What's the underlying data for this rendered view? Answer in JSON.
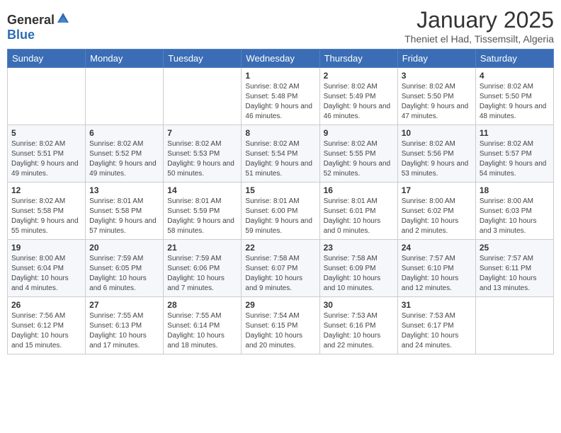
{
  "header": {
    "logo_general": "General",
    "logo_blue": "Blue",
    "month_title": "January 2025",
    "subtitle": "Theniet el Had, Tissemsilt, Algeria"
  },
  "days_of_week": [
    "Sunday",
    "Monday",
    "Tuesday",
    "Wednesday",
    "Thursday",
    "Friday",
    "Saturday"
  ],
  "weeks": [
    [
      {
        "day": "",
        "sunrise": "",
        "sunset": "",
        "daylight": ""
      },
      {
        "day": "",
        "sunrise": "",
        "sunset": "",
        "daylight": ""
      },
      {
        "day": "",
        "sunrise": "",
        "sunset": "",
        "daylight": ""
      },
      {
        "day": "1",
        "sunrise": "Sunrise: 8:02 AM",
        "sunset": "Sunset: 5:48 PM",
        "daylight": "Daylight: 9 hours and 46 minutes."
      },
      {
        "day": "2",
        "sunrise": "Sunrise: 8:02 AM",
        "sunset": "Sunset: 5:49 PM",
        "daylight": "Daylight: 9 hours and 46 minutes."
      },
      {
        "day": "3",
        "sunrise": "Sunrise: 8:02 AM",
        "sunset": "Sunset: 5:50 PM",
        "daylight": "Daylight: 9 hours and 47 minutes."
      },
      {
        "day": "4",
        "sunrise": "Sunrise: 8:02 AM",
        "sunset": "Sunset: 5:50 PM",
        "daylight": "Daylight: 9 hours and 48 minutes."
      }
    ],
    [
      {
        "day": "5",
        "sunrise": "Sunrise: 8:02 AM",
        "sunset": "Sunset: 5:51 PM",
        "daylight": "Daylight: 9 hours and 49 minutes."
      },
      {
        "day": "6",
        "sunrise": "Sunrise: 8:02 AM",
        "sunset": "Sunset: 5:52 PM",
        "daylight": "Daylight: 9 hours and 49 minutes."
      },
      {
        "day": "7",
        "sunrise": "Sunrise: 8:02 AM",
        "sunset": "Sunset: 5:53 PM",
        "daylight": "Daylight: 9 hours and 50 minutes."
      },
      {
        "day": "8",
        "sunrise": "Sunrise: 8:02 AM",
        "sunset": "Sunset: 5:54 PM",
        "daylight": "Daylight: 9 hours and 51 minutes."
      },
      {
        "day": "9",
        "sunrise": "Sunrise: 8:02 AM",
        "sunset": "Sunset: 5:55 PM",
        "daylight": "Daylight: 9 hours and 52 minutes."
      },
      {
        "day": "10",
        "sunrise": "Sunrise: 8:02 AM",
        "sunset": "Sunset: 5:56 PM",
        "daylight": "Daylight: 9 hours and 53 minutes."
      },
      {
        "day": "11",
        "sunrise": "Sunrise: 8:02 AM",
        "sunset": "Sunset: 5:57 PM",
        "daylight": "Daylight: 9 hours and 54 minutes."
      }
    ],
    [
      {
        "day": "12",
        "sunrise": "Sunrise: 8:02 AM",
        "sunset": "Sunset: 5:58 PM",
        "daylight": "Daylight: 9 hours and 55 minutes."
      },
      {
        "day": "13",
        "sunrise": "Sunrise: 8:01 AM",
        "sunset": "Sunset: 5:58 PM",
        "daylight": "Daylight: 9 hours and 57 minutes."
      },
      {
        "day": "14",
        "sunrise": "Sunrise: 8:01 AM",
        "sunset": "Sunset: 5:59 PM",
        "daylight": "Daylight: 9 hours and 58 minutes."
      },
      {
        "day": "15",
        "sunrise": "Sunrise: 8:01 AM",
        "sunset": "Sunset: 6:00 PM",
        "daylight": "Daylight: 9 hours and 59 minutes."
      },
      {
        "day": "16",
        "sunrise": "Sunrise: 8:01 AM",
        "sunset": "Sunset: 6:01 PM",
        "daylight": "Daylight: 10 hours and 0 minutes."
      },
      {
        "day": "17",
        "sunrise": "Sunrise: 8:00 AM",
        "sunset": "Sunset: 6:02 PM",
        "daylight": "Daylight: 10 hours and 2 minutes."
      },
      {
        "day": "18",
        "sunrise": "Sunrise: 8:00 AM",
        "sunset": "Sunset: 6:03 PM",
        "daylight": "Daylight: 10 hours and 3 minutes."
      }
    ],
    [
      {
        "day": "19",
        "sunrise": "Sunrise: 8:00 AM",
        "sunset": "Sunset: 6:04 PM",
        "daylight": "Daylight: 10 hours and 4 minutes."
      },
      {
        "day": "20",
        "sunrise": "Sunrise: 7:59 AM",
        "sunset": "Sunset: 6:05 PM",
        "daylight": "Daylight: 10 hours and 6 minutes."
      },
      {
        "day": "21",
        "sunrise": "Sunrise: 7:59 AM",
        "sunset": "Sunset: 6:06 PM",
        "daylight": "Daylight: 10 hours and 7 minutes."
      },
      {
        "day": "22",
        "sunrise": "Sunrise: 7:58 AM",
        "sunset": "Sunset: 6:07 PM",
        "daylight": "Daylight: 10 hours and 9 minutes."
      },
      {
        "day": "23",
        "sunrise": "Sunrise: 7:58 AM",
        "sunset": "Sunset: 6:09 PM",
        "daylight": "Daylight: 10 hours and 10 minutes."
      },
      {
        "day": "24",
        "sunrise": "Sunrise: 7:57 AM",
        "sunset": "Sunset: 6:10 PM",
        "daylight": "Daylight: 10 hours and 12 minutes."
      },
      {
        "day": "25",
        "sunrise": "Sunrise: 7:57 AM",
        "sunset": "Sunset: 6:11 PM",
        "daylight": "Daylight: 10 hours and 13 minutes."
      }
    ],
    [
      {
        "day": "26",
        "sunrise": "Sunrise: 7:56 AM",
        "sunset": "Sunset: 6:12 PM",
        "daylight": "Daylight: 10 hours and 15 minutes."
      },
      {
        "day": "27",
        "sunrise": "Sunrise: 7:55 AM",
        "sunset": "Sunset: 6:13 PM",
        "daylight": "Daylight: 10 hours and 17 minutes."
      },
      {
        "day": "28",
        "sunrise": "Sunrise: 7:55 AM",
        "sunset": "Sunset: 6:14 PM",
        "daylight": "Daylight: 10 hours and 18 minutes."
      },
      {
        "day": "29",
        "sunrise": "Sunrise: 7:54 AM",
        "sunset": "Sunset: 6:15 PM",
        "daylight": "Daylight: 10 hours and 20 minutes."
      },
      {
        "day": "30",
        "sunrise": "Sunrise: 7:53 AM",
        "sunset": "Sunset: 6:16 PM",
        "daylight": "Daylight: 10 hours and 22 minutes."
      },
      {
        "day": "31",
        "sunrise": "Sunrise: 7:53 AM",
        "sunset": "Sunset: 6:17 PM",
        "daylight": "Daylight: 10 hours and 24 minutes."
      },
      {
        "day": "",
        "sunrise": "",
        "sunset": "",
        "daylight": ""
      }
    ]
  ]
}
